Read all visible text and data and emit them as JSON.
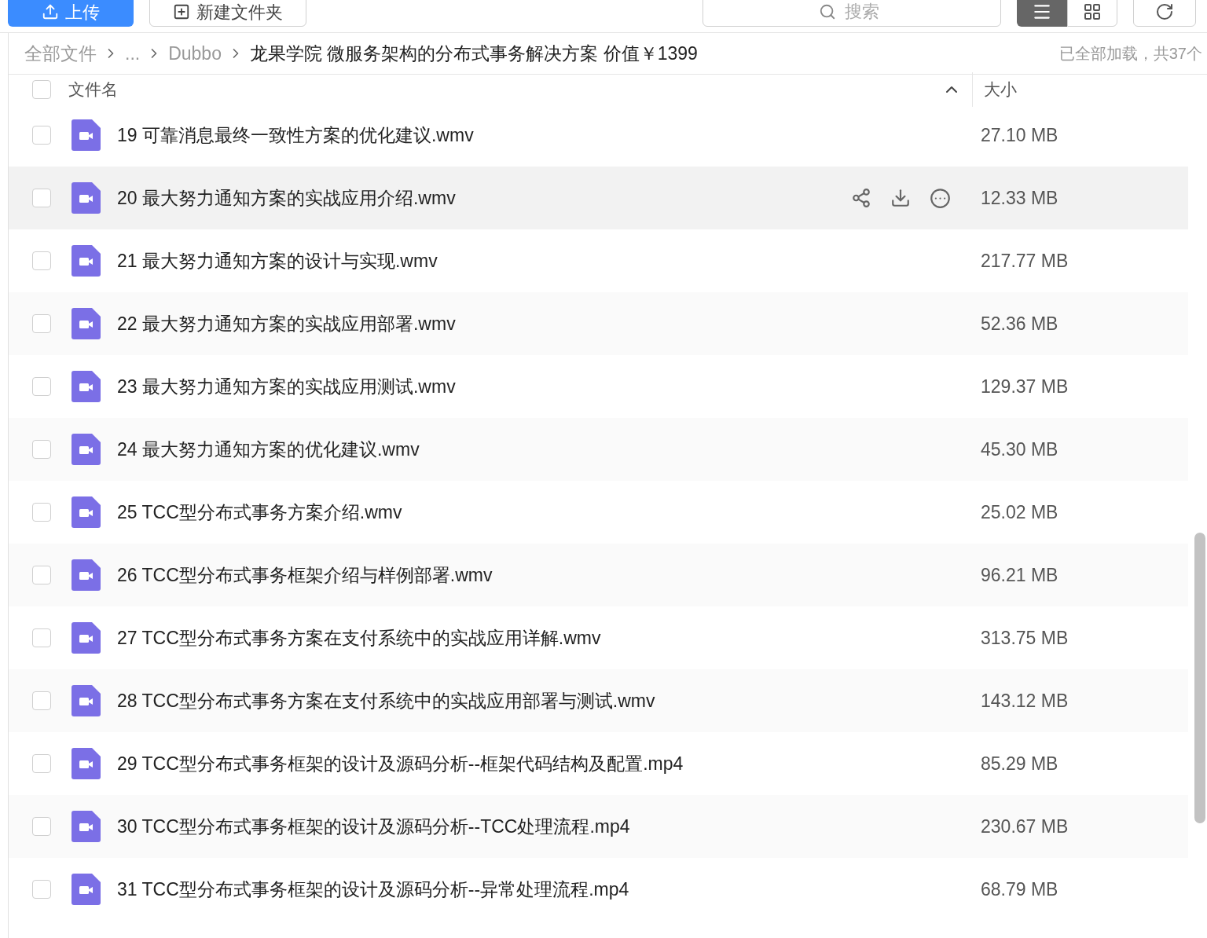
{
  "toolbar": {
    "upload": "上传",
    "new_folder": "新建文件夹",
    "search": {
      "placeholder": "搜索"
    },
    "view_buttons": [
      {
        "kind": "list",
        "selected": true
      },
      {
        "kind": "grid",
        "selected": false
      }
    ]
  },
  "breadcrumb": {
    "items": [
      "全部文件",
      "...",
      "Dubbo",
      "龙果学院 微服务架构的分布式事务解决方案 价值￥1399"
    ],
    "status": "已全部加载，共37个"
  },
  "table": {
    "columns": [
      "文件名",
      "大小"
    ],
    "all_checked": false,
    "rows": [
      {
        "name": "19 可靠消息最终一致性方案的优化建议.wmv",
        "size": "27.10 MB",
        "checked": false,
        "hovered": false
      },
      {
        "name": "20 最大努力通知方案的实战应用介绍.wmv",
        "size": "12.33 MB",
        "checked": false,
        "hovered": true
      },
      {
        "name": "21 最大努力通知方案的设计与实现.wmv",
        "size": "217.77 MB",
        "checked": false,
        "hovered": false
      },
      {
        "name": "22 最大努力通知方案的实战应用部署.wmv",
        "size": "52.36 MB",
        "checked": false,
        "hovered": false
      },
      {
        "name": "23 最大努力通知方案的实战应用测试.wmv",
        "size": "129.37 MB",
        "checked": false,
        "hovered": false
      },
      {
        "name": "24 最大努力通知方案的优化建议.wmv",
        "size": "45.30 MB",
        "checked": false,
        "hovered": false
      },
      {
        "name": "25 TCC型分布式事务方案介绍.wmv",
        "size": "25.02 MB",
        "checked": false,
        "hovered": false
      },
      {
        "name": "26 TCC型分布式事务框架介绍与样例部署.wmv",
        "size": "96.21 MB",
        "checked": false,
        "hovered": false
      },
      {
        "name": "27 TCC型分布式事务方案在支付系统中的实战应用详解.wmv",
        "size": "313.75 MB",
        "checked": false,
        "hovered": false
      },
      {
        "name": "28 TCC型分布式事务方案在支付系统中的实战应用部署与测试.wmv",
        "size": "143.12 MB",
        "checked": false,
        "hovered": false
      },
      {
        "name": "29 TCC型分布式事务框架的设计及源码分析--框架代码结构及配置.mp4",
        "size": "85.29 MB",
        "checked": false,
        "hovered": false
      },
      {
        "name": "30 TCC型分布式事务框架的设计及源码分析--TCC处理流程.mp4",
        "size": "230.67 MB",
        "checked": false,
        "hovered": false
      },
      {
        "name": "31 TCC型分布式事务框架的设计及源码分析--异常处理流程.mp4",
        "size": "68.79 MB",
        "checked": false,
        "hovered": false
      }
    ]
  }
}
